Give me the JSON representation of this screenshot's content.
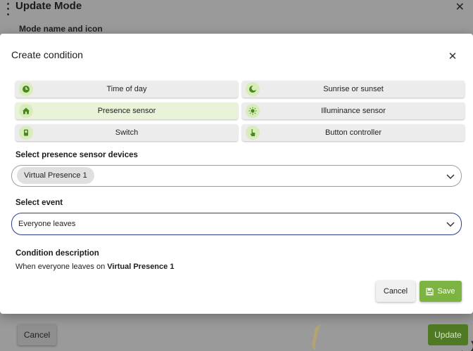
{
  "background": {
    "title": "Update Mode",
    "subtitle": "Mode name and icon",
    "cancel_label": "Cancel",
    "update_label": "Update"
  },
  "modal": {
    "title": "Create condition",
    "condition_types": [
      {
        "label": "Time of day",
        "icon": "clock-icon"
      },
      {
        "label": "Sunrise or sunset",
        "icon": "moon-icon"
      },
      {
        "label": "Presence sensor",
        "icon": "home-icon",
        "selected": true
      },
      {
        "label": "Illuminance sensor",
        "icon": "sun-icon"
      },
      {
        "label": "Switch",
        "icon": "switch-icon"
      },
      {
        "label": "Button controller",
        "icon": "hand-pointer-icon"
      }
    ],
    "devices_label": "Select presence sensor devices",
    "selected_device": "Virtual Presence 1",
    "event_label": "Select event",
    "event_value": "Everyone leaves",
    "description_label": "Condition description",
    "description_prefix": "When everyone leaves on ",
    "description_device": "Virtual Presence 1",
    "cancel_label": "Cancel",
    "save_label": "Save"
  },
  "colors": {
    "accent_green": "#7cb342",
    "selected_bg": "#e8f3d8",
    "focus_border": "#2c3f8f"
  }
}
